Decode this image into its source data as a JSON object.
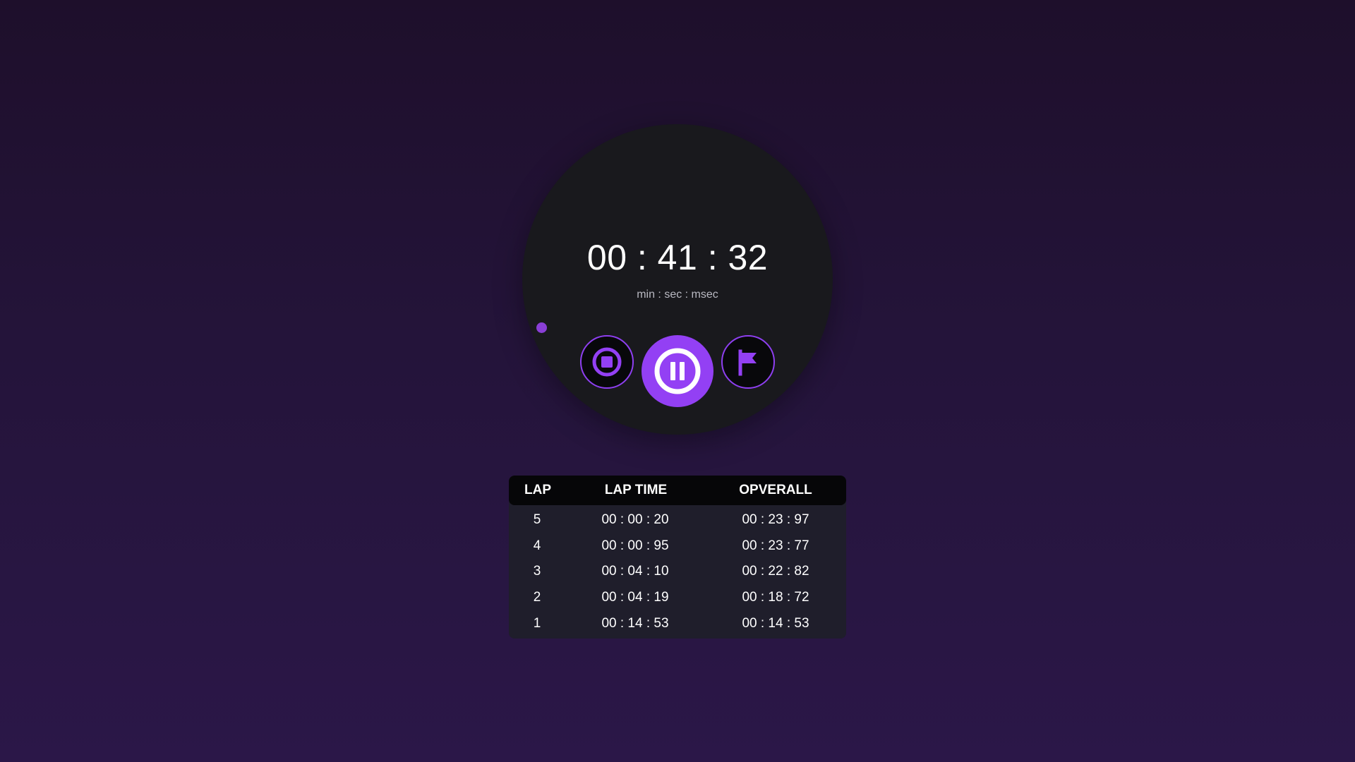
{
  "timer": {
    "display": "00 : 41 : 32",
    "units": "min : sec : msec"
  },
  "controls": {
    "stop_icon": "stop-icon",
    "pause_icon": "pause-icon",
    "lap_icon": "flag-icon"
  },
  "colors": {
    "accent": "#9340f4",
    "dial": "#19191d",
    "progress_dot": "#8a3fd6"
  },
  "laps": {
    "headers": [
      "LAP",
      "LAP TIME",
      "OPVERALL"
    ],
    "rows": [
      {
        "lap": "5",
        "lap_time": "00 : 00 : 20",
        "overall": "00 : 23 : 97"
      },
      {
        "lap": "4",
        "lap_time": "00 : 00 : 95",
        "overall": "00 : 23 : 77"
      },
      {
        "lap": "3",
        "lap_time": "00 : 04 : 10",
        "overall": "00 : 22 : 82"
      },
      {
        "lap": "2",
        "lap_time": "00 : 04 : 19",
        "overall": "00 : 18 : 72"
      },
      {
        "lap": "1",
        "lap_time": "00 : 14 : 53",
        "overall": "00 : 14 : 53"
      }
    ]
  }
}
